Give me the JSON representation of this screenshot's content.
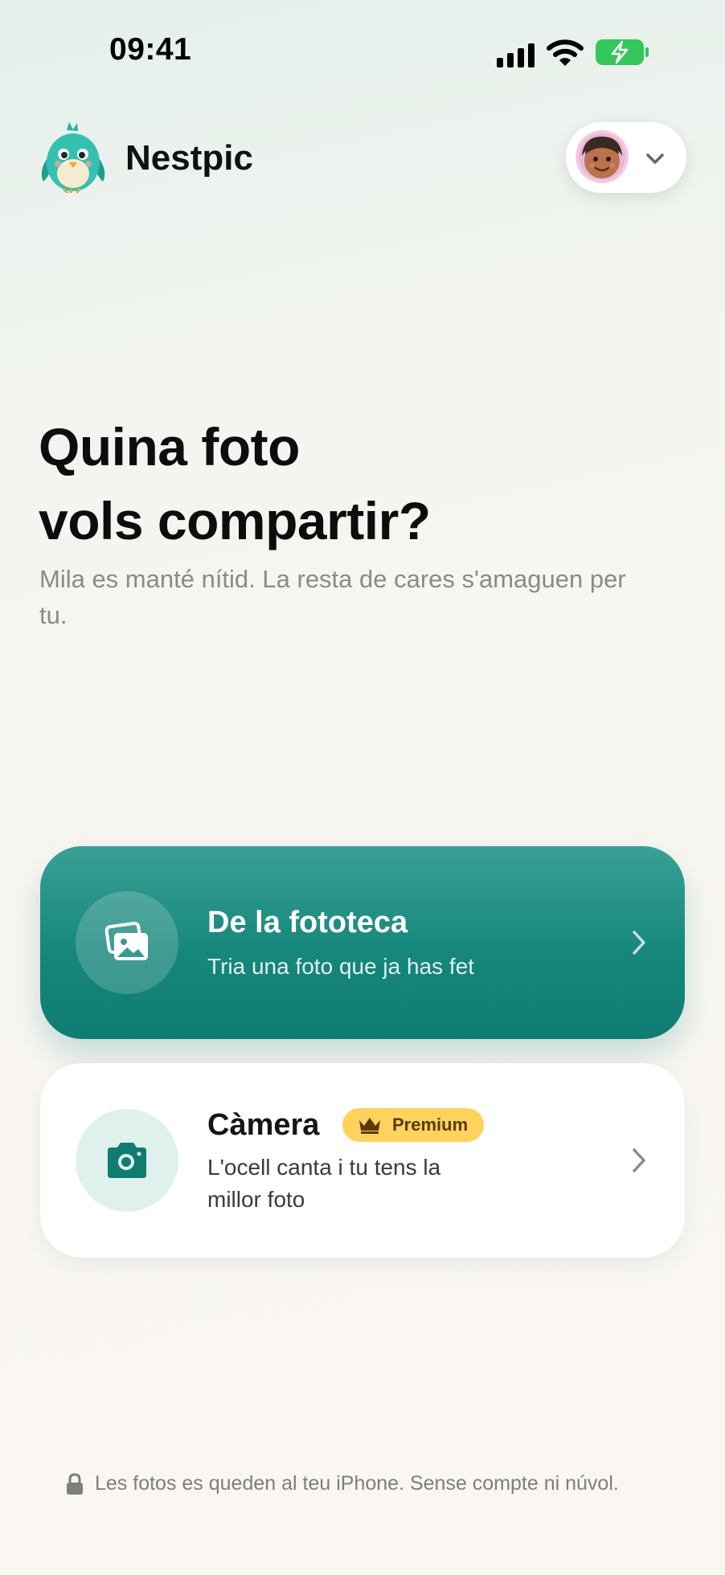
{
  "status_bar": {
    "time": "09:41",
    "icons": [
      "cellular-signal-icon",
      "wifi-icon",
      "battery-charging-icon"
    ],
    "battery_color": "#34c759"
  },
  "header": {
    "app_name": "Nestpic",
    "logo_icon": "bird-mascot-icon",
    "profile": {
      "avatar_icon": "child-avatar-icon",
      "dropdown_icon": "chevron-down-icon"
    }
  },
  "hero": {
    "title_line1": "Quina foto",
    "title_line2": "vols compartir?",
    "subtitle": "Mila es manté nítid. La resta de cares s'amaguen per tu."
  },
  "options": {
    "library": {
      "title": "De la fototeca",
      "description": "Tria una foto que ja has fet",
      "icon": "photo-library-icon",
      "accent": "#0f7c72"
    },
    "camera": {
      "title": "Càmera",
      "badge": "Premium",
      "badge_icon": "crown-icon",
      "badge_color": "#ffd25e",
      "description": "L'ocell canta i tu tens la millor foto",
      "icon": "camera-icon"
    }
  },
  "footer": {
    "icon": "lock-icon",
    "text": "Les fotos es queden al teu iPhone. Sense compte ni núvol."
  }
}
